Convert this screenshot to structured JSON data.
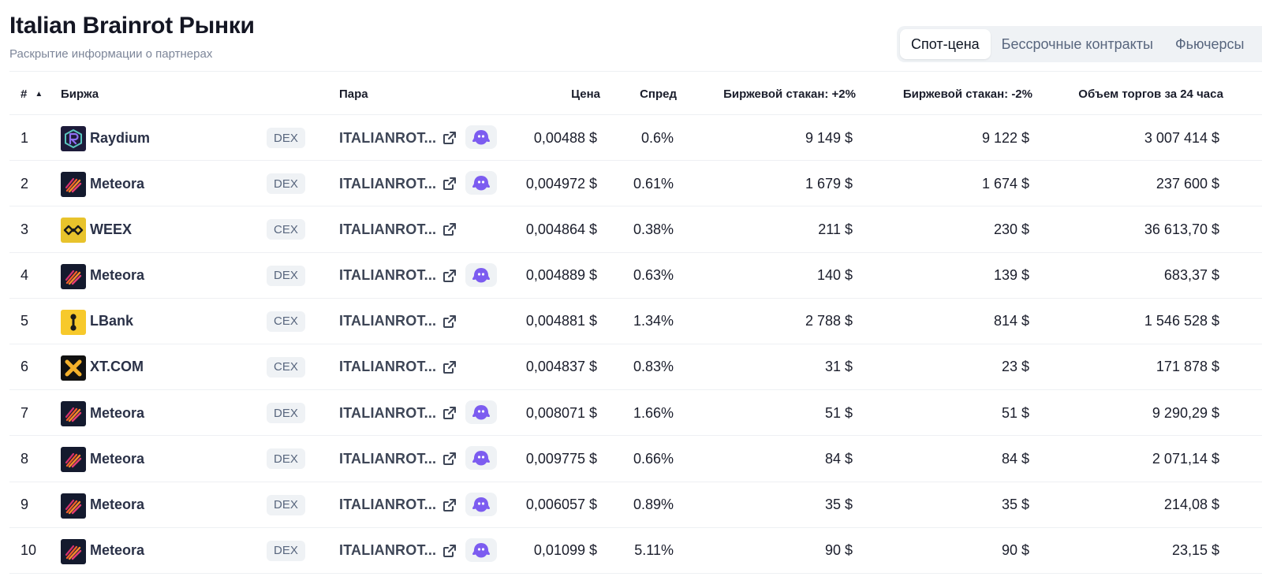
{
  "header": {
    "title": "Italian Brainrot Рынки",
    "subtitle": "Раскрытие информации о партнерах"
  },
  "tabs": [
    {
      "label": "Спот-цена",
      "active": true
    },
    {
      "label": "Бессрочные контракты",
      "active": false
    },
    {
      "label": "Фьючерсы",
      "active": false
    }
  ],
  "table": {
    "columns": {
      "num": "#",
      "exchange": "Биржа",
      "pair": "Пара",
      "price": "Цена",
      "spread": "Спред",
      "depth_plus": "Биржевой стакан: +2%",
      "depth_minus": "Биржевой стакан: -2%",
      "volume": "Объем торгов за 24 часа"
    },
    "rows": [
      {
        "num": "1",
        "exchange": "Raydium",
        "logo": "raydium",
        "type": "DEX",
        "pair": "ITALIANROT...",
        "pool": true,
        "price": "0,00488 $",
        "spread": "0.6%",
        "depth_plus": "9 149 $",
        "depth_minus": "9 122 $",
        "volume": "3 007 414 $"
      },
      {
        "num": "2",
        "exchange": "Meteora",
        "logo": "meteora",
        "type": "DEX",
        "pair": "ITALIANROT...",
        "pool": true,
        "price": "0,004972 $",
        "spread": "0.61%",
        "depth_plus": "1 679 $",
        "depth_minus": "1 674 $",
        "volume": "237 600 $"
      },
      {
        "num": "3",
        "exchange": "WEEX",
        "logo": "weex",
        "type": "CEX",
        "pair": "ITALIANROT...",
        "pool": false,
        "price": "0,004864 $",
        "spread": "0.38%",
        "depth_plus": "211 $",
        "depth_minus": "230 $",
        "volume": "36 613,70 $"
      },
      {
        "num": "4",
        "exchange": "Meteora",
        "logo": "meteora",
        "type": "DEX",
        "pair": "ITALIANROT...",
        "pool": true,
        "price": "0,004889 $",
        "spread": "0.63%",
        "depth_plus": "140 $",
        "depth_minus": "139 $",
        "volume": "683,37 $"
      },
      {
        "num": "5",
        "exchange": "LBank",
        "logo": "lbank",
        "type": "CEX",
        "pair": "ITALIANROT...",
        "pool": false,
        "price": "0,004881 $",
        "spread": "1.34%",
        "depth_plus": "2 788 $",
        "depth_minus": "814 $",
        "volume": "1 546 528 $"
      },
      {
        "num": "6",
        "exchange": "XT.COM",
        "logo": "xt",
        "type": "CEX",
        "pair": "ITALIANROT...",
        "pool": false,
        "price": "0,004837 $",
        "spread": "0.83%",
        "depth_plus": "31 $",
        "depth_minus": "23 $",
        "volume": "171 878 $"
      },
      {
        "num": "7",
        "exchange": "Meteora",
        "logo": "meteora",
        "type": "DEX",
        "pair": "ITALIANROT...",
        "pool": true,
        "price": "0,008071 $",
        "spread": "1.66%",
        "depth_plus": "51 $",
        "depth_minus": "51 $",
        "volume": "9 290,29 $"
      },
      {
        "num": "8",
        "exchange": "Meteora",
        "logo": "meteora",
        "type": "DEX",
        "pair": "ITALIANROT...",
        "pool": true,
        "price": "0,009775 $",
        "spread": "0.66%",
        "depth_plus": "84 $",
        "depth_minus": "84 $",
        "volume": "2 071,14 $"
      },
      {
        "num": "9",
        "exchange": "Meteora",
        "logo": "meteora",
        "type": "DEX",
        "pair": "ITALIANROT...",
        "pool": true,
        "price": "0,006057 $",
        "spread": "0.89%",
        "depth_plus": "35 $",
        "depth_minus": "35 $",
        "volume": "214,08 $"
      },
      {
        "num": "10",
        "exchange": "Meteora",
        "logo": "meteora",
        "type": "DEX",
        "pair": "ITALIANROT...",
        "pool": true,
        "price": "0,01099 $",
        "spread": "5.11%",
        "depth_plus": "90 $",
        "depth_minus": "90 $",
        "volume": "23,15 $"
      }
    ]
  },
  "icons": {
    "sort": "sort-asc-icon",
    "external_link": "external-link-icon",
    "pool": "ghost-pool-icon"
  },
  "colors": {
    "accent_purple": "#7c5cf0",
    "badge_bg": "#eff2f5",
    "muted_text": "#7d8699"
  }
}
